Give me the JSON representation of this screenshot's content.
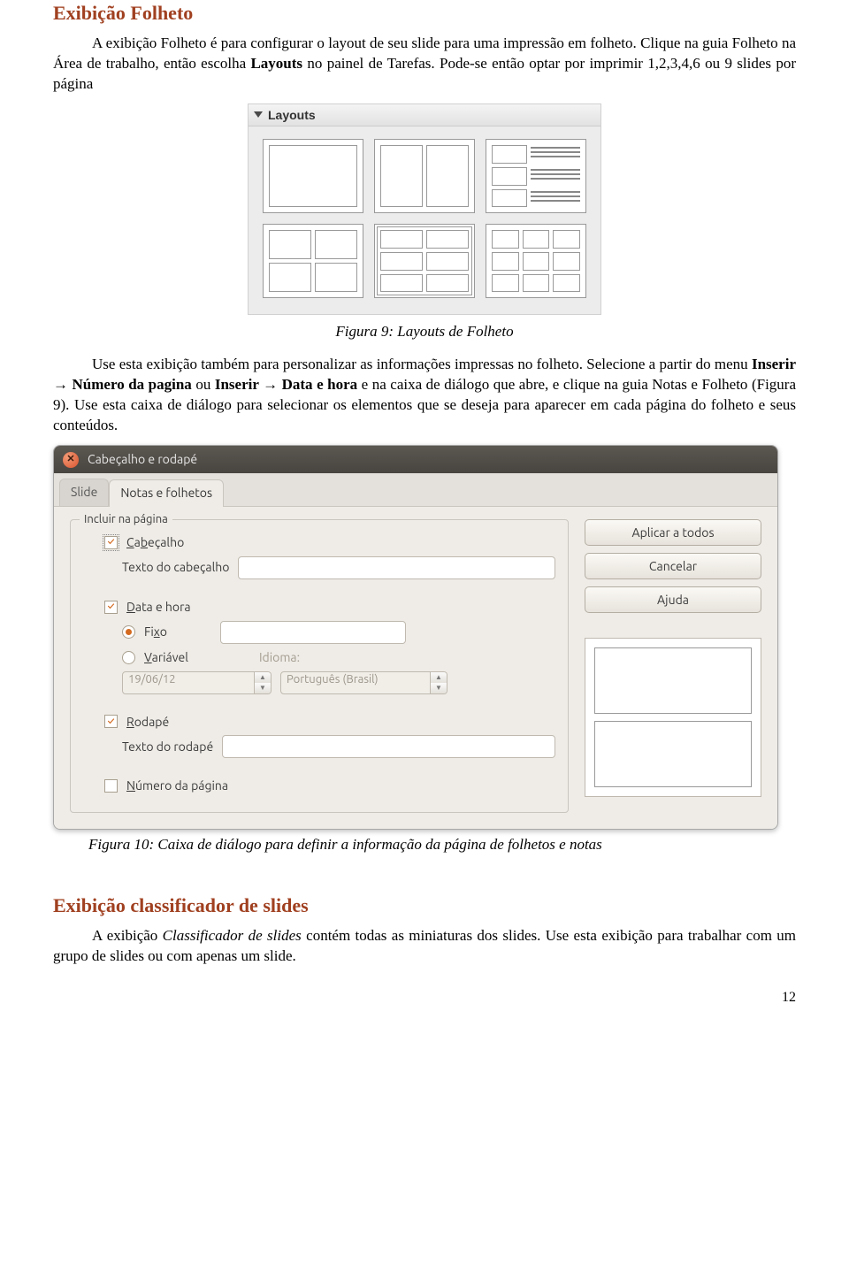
{
  "section1": {
    "title": "Exibição Folheto",
    "para1_pre": "A exibição Folheto é para configurar o layout de seu slide para uma impressão em folheto. Clique na guia Folheto na Área de trabalho, então escolha ",
    "para1_bold": "Layouts",
    "para1_post": " no painel de Tarefas. Pode-se então optar por imprimir 1,2,3,4,6 ou 9 slides por página",
    "caption9": "Figura 9: Layouts de Folheto",
    "para2_pre": "Use esta exibição também para personalizar as informações impressas no folheto. Selecione a partir do menu ",
    "para2_b1": "Inserir → Número da pagina",
    "para2_mid1": " ou ",
    "para2_b2": "Inserir → Data e hora",
    "para2_mid2": " e na caixa de diálogo que abre, e clique na guia Notas e Folheto (Figura 9). Use esta caixa de diálogo para selecionar os elementos que se deseja para aparecer em cada página do folheto e seus conteúdos."
  },
  "layouts_panel": {
    "title": "Layouts"
  },
  "dialog": {
    "title": "Cabeçalho e rodapé",
    "tabs": {
      "slide": "Slide",
      "notas": "Notas e folhetos"
    },
    "legend": "Incluir na página",
    "cabecalho": "Cabeçalho",
    "texto_cabecalho": "Texto do cabeçalho",
    "data_hora": "Data e hora",
    "fixo": "Fixo",
    "variavel": "Variável",
    "idioma": "Idioma:",
    "date_value": "19/06/12",
    "lang_value": "Português (Brasil)",
    "rodape": "Rodapé",
    "texto_rodape": "Texto do rodapé",
    "numero_pagina": "Número da página",
    "buttons": {
      "aplicar": "Aplicar a todos",
      "cancelar": "Cancelar",
      "ajuda": "Ajuda"
    }
  },
  "caption10": "Figura 10: Caixa de diálogo para definir a informação da página de folhetos e notas",
  "section2": {
    "title": "Exibição classificador de slides",
    "para_pre": "A exibição ",
    "para_em": "Classificador de slides",
    "para_post": " contém todas as miniaturas dos slides. Use esta exibição para trabalhar com um grupo de slides ou com apenas um slide."
  },
  "page_number": "12"
}
